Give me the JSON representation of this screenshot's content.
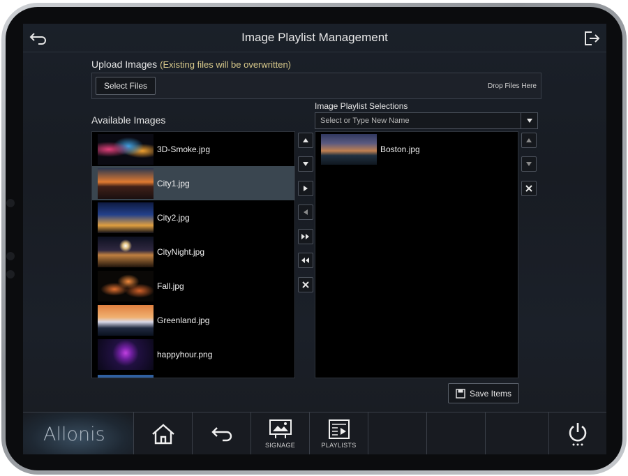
{
  "header": {
    "title": "Image Playlist Management"
  },
  "upload": {
    "label": "Upload Images",
    "note": "(Existing files will be overwritten)",
    "select_files_label": "Select Files",
    "drop_text": "Drop Files Here"
  },
  "available": {
    "label": "Available Images",
    "items": [
      {
        "name": "3D-Smoke.jpg",
        "selected": false
      },
      {
        "name": "City1.jpg",
        "selected": true
      },
      {
        "name": "City2.jpg",
        "selected": false
      },
      {
        "name": "CityNight.jpg",
        "selected": false
      },
      {
        "name": "Fall.jpg",
        "selected": false
      },
      {
        "name": "Greenland.jpg",
        "selected": false
      },
      {
        "name": "happyhour.png",
        "selected": false
      }
    ]
  },
  "playlist": {
    "label": "Image Playlist Selections",
    "select_placeholder": "Select or Type New Name",
    "items": [
      {
        "name": "Boston.jpg"
      }
    ]
  },
  "save_label": "Save Items",
  "nav": {
    "logo": "Allonis",
    "signage_label": "SIGNAGE",
    "playlists_label": "PLAYLISTS"
  },
  "icons": {
    "back": "back-arrow-icon",
    "logout": "logout-icon",
    "home": "home-icon",
    "power": "power-icon"
  }
}
